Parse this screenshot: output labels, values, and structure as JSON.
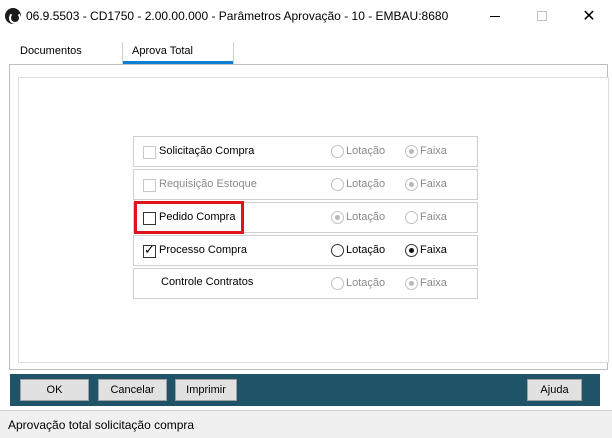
{
  "window": {
    "title": "06.9.5503 - CD1750 - 2.00.00.000 - Parâmetros Aprovação - 10 - EMBAU:8680",
    "close_glyph": "✕"
  },
  "tabs": [
    {
      "label": "Documentos",
      "active": false
    },
    {
      "label": "Aprova Total",
      "active": true
    }
  ],
  "options": [
    {
      "label": "Solicitação Compra",
      "has_checkbox": true,
      "checked": false,
      "enabled": false,
      "lotacao": "Lotação",
      "faixa": "Faixa",
      "selected": "faixa"
    },
    {
      "label": "Requisição Estoque",
      "has_checkbox": true,
      "checked": false,
      "enabled": false,
      "lotacao": "Lotação",
      "faixa": "Faixa",
      "selected": "faixa"
    },
    {
      "label": "Pedido Compra",
      "has_checkbox": true,
      "checked": false,
      "enabled": false,
      "lotacao": "Lotação",
      "faixa": "Faixa",
      "selected": "lotacao"
    },
    {
      "label": "Processo Compra",
      "has_checkbox": true,
      "checked": true,
      "enabled": true,
      "lotacao": "Lotação",
      "faixa": "Faixa",
      "selected": "faixa"
    },
    {
      "label": "Controle Contratos",
      "has_checkbox": false,
      "checked": false,
      "enabled": false,
      "lotacao": "Lotação",
      "faixa": "Faixa",
      "selected": "faixa"
    }
  ],
  "toolbar": {
    "ok_label": "OK",
    "cancel_label": "Cancelar",
    "print_label": "Imprimir",
    "help_label": "Ajuda"
  },
  "status": {
    "text": "Aprovação total solicitação compra"
  },
  "colors": {
    "toolbar_bg": "#1f5368",
    "tab_accent": "#0a7fd4",
    "highlight": "#e0151b"
  }
}
